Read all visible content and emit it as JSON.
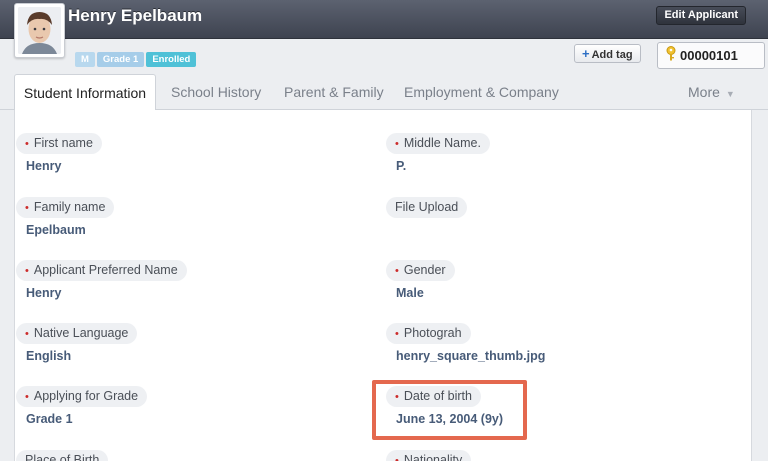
{
  "header": {
    "name": "Henry Epelbaum",
    "edit_button": "Edit Applicant"
  },
  "tags": [
    "M",
    "Grade 1",
    "Enrolled"
  ],
  "add_tag": "Add tag",
  "applicant_id": "00000101",
  "tabs": [
    {
      "label": "Student Information"
    },
    {
      "label": "School History"
    },
    {
      "label": "Parent & Family"
    },
    {
      "label": "Employment & Company"
    },
    {
      "label": "More"
    }
  ],
  "fields": {
    "first_name": {
      "label": "First name",
      "value": "Henry"
    },
    "middle_name": {
      "label": "Middle Name.",
      "value": "P."
    },
    "family_name": {
      "label": "Family name",
      "value": "Epelbaum"
    },
    "file_upload": {
      "label": "File Upload",
      "value": ""
    },
    "preferred_name": {
      "label": "Applicant Preferred Name",
      "value": "Henry"
    },
    "gender": {
      "label": "Gender",
      "value": "Male"
    },
    "native_language": {
      "label": "Native Language",
      "value": "English"
    },
    "photograph": {
      "label": "Photograh",
      "value": "henry_square_thumb.jpg"
    },
    "applying_grade": {
      "label": "Applying for Grade",
      "value": "Grade 1"
    },
    "date_of_birth": {
      "label": "Date of birth",
      "value": "June 13, 2004 (9y)"
    },
    "place_of_birth": {
      "label": "Place of Birth",
      "value": ""
    },
    "nationality": {
      "label": "Nationality",
      "value": ""
    }
  },
  "colors": {
    "header_bg": "#4a4f5b",
    "tag_enrolled": "#4fc1d7",
    "value_text": "#475b78",
    "required_marker": "#cc2c2c",
    "highlight_border": "#e4684e"
  }
}
